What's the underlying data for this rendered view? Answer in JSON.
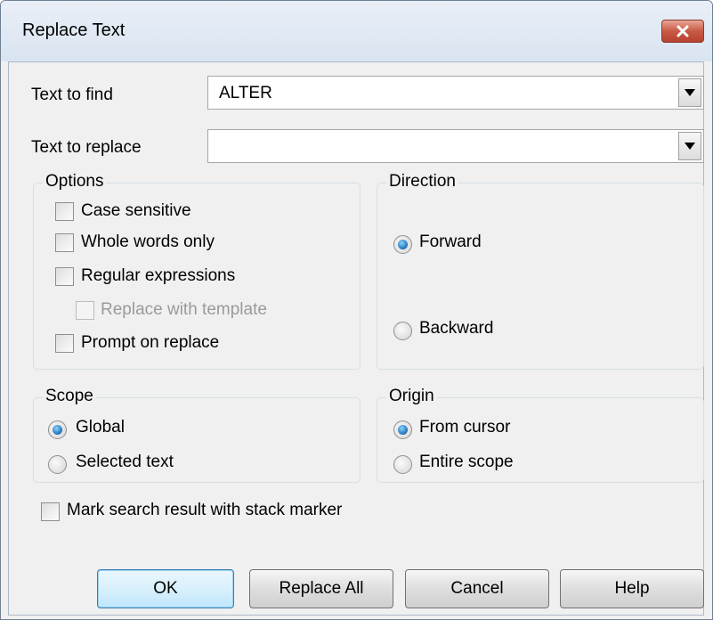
{
  "window": {
    "title": "Replace Text"
  },
  "find": {
    "label": "Text to find",
    "value": "ALTER"
  },
  "replace": {
    "label": "Text to replace",
    "value": ""
  },
  "options": {
    "legend": "Options",
    "case_sensitive": {
      "label": "Case sensitive",
      "checked": false
    },
    "whole_words": {
      "label": "Whole words only",
      "checked": false
    },
    "regex": {
      "label": "Regular expressions",
      "checked": false
    },
    "template": {
      "label": "Replace with template",
      "checked": false,
      "enabled": false
    },
    "prompt": {
      "label": "Prompt on replace",
      "checked": false
    }
  },
  "direction": {
    "legend": "Direction",
    "forward": {
      "label": "Forward",
      "selected": true
    },
    "backward": {
      "label": "Backward",
      "selected": false
    }
  },
  "scope": {
    "legend": "Scope",
    "global": {
      "label": "Global",
      "selected": true
    },
    "selected": {
      "label": "Selected text",
      "selected": false
    }
  },
  "origin": {
    "legend": "Origin",
    "from_cursor": {
      "label": "From cursor",
      "selected": true
    },
    "entire_scope": {
      "label": "Entire scope",
      "selected": false
    }
  },
  "mark": {
    "label": "Mark search result with stack marker",
    "checked": false
  },
  "buttons": {
    "ok": "OK",
    "replace_all": "Replace All",
    "cancel": "Cancel",
    "help": "Help"
  },
  "icons": {
    "close": "close-icon",
    "dropdown": "chevron-down-icon"
  },
  "colors": {
    "accent": "#1c6fb5",
    "close_button": "#c75a45",
    "default_button_border": "#3c7fb1"
  }
}
